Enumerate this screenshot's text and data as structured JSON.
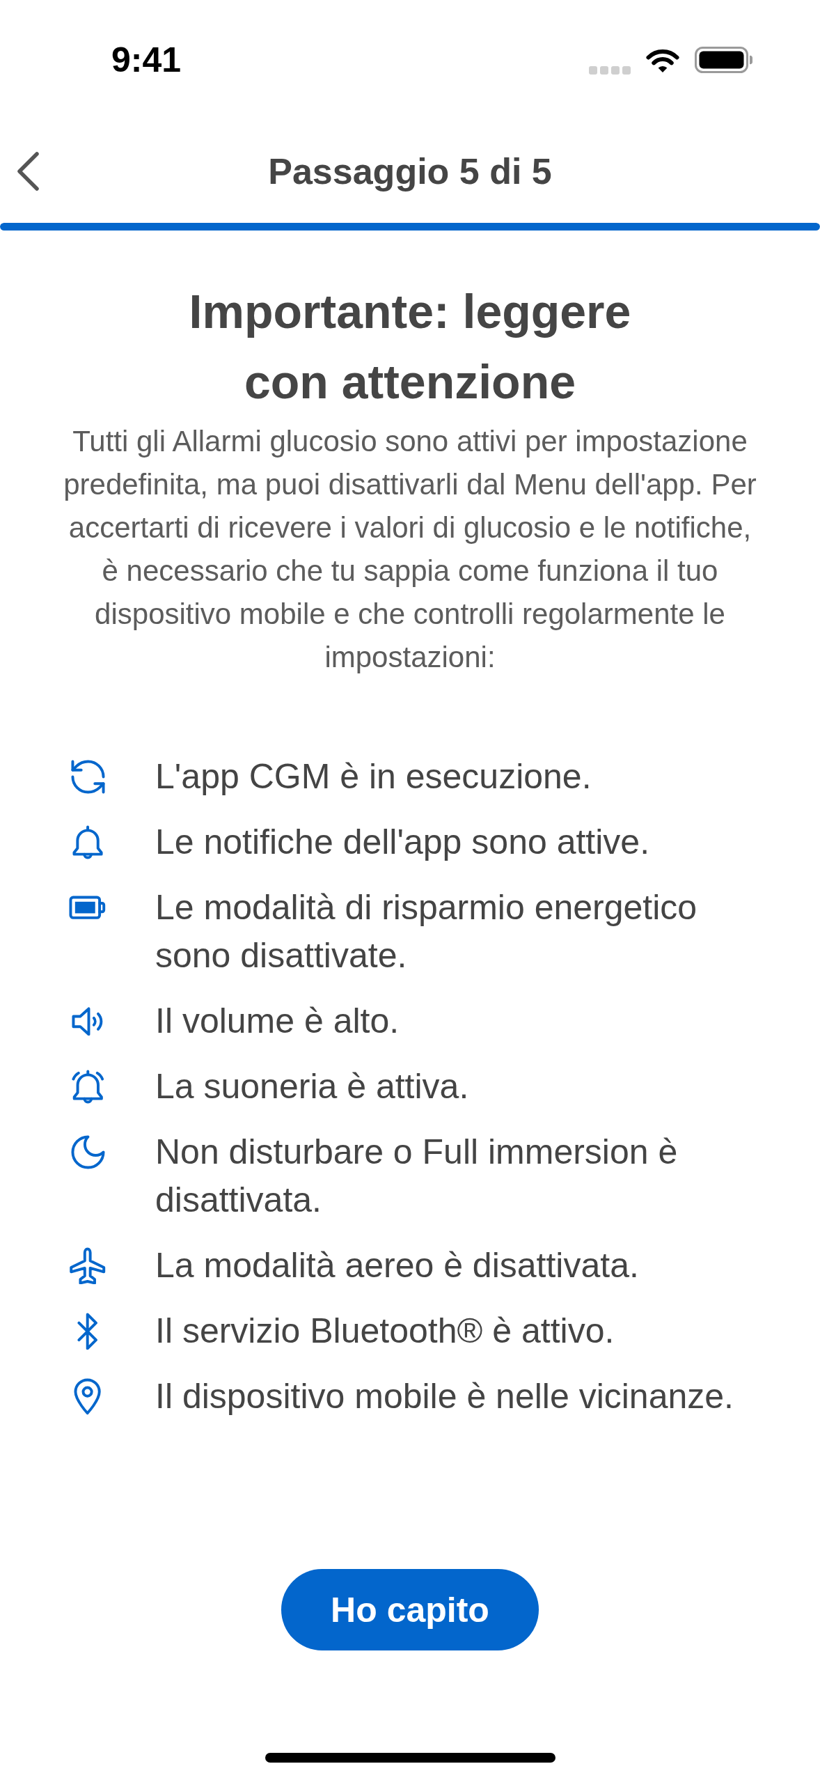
{
  "status_bar": {
    "time": "9:41"
  },
  "header": {
    "title": "Passaggio 5 di 5",
    "progress": {
      "level": 1
    }
  },
  "content": {
    "heading": "Importante: leggere con attenzione",
    "intro": "Tutti gli Allarmi glucosio sono attivi per impostazione predefinita, ma puoi disattivarli dal Menu dell'app. Per accertarti di ricevere i valori di glucosio e le notifiche, è necessario che tu sappia come funziona il tuo dispositivo mobile e che controlli regolarmente le impostazioni:",
    "checklist": [
      {
        "kind": "sync",
        "text": "L'app CGM è in esecuzione."
      },
      {
        "kind": "notifications",
        "text": "Le notifiche dell'app sono attive."
      },
      {
        "kind": "battery",
        "text": "Le modalità di risparmio energetico sono disattivate."
      },
      {
        "kind": "volume",
        "text": "Il volume è alto."
      },
      {
        "kind": "ringer",
        "text": "La suoneria è attiva."
      },
      {
        "kind": "focus",
        "text": "Non disturbare o Full immersion è disattivata."
      },
      {
        "kind": "airplane",
        "text": "La modalità aereo è disattivata."
      },
      {
        "kind": "bluetooth",
        "text": "Il servizio Bluetooth® è attivo."
      },
      {
        "kind": "location",
        "text": "Il dispositivo mobile è nelle vicinanze."
      }
    ]
  },
  "primary_button": {
    "label": "Ho capito"
  }
}
